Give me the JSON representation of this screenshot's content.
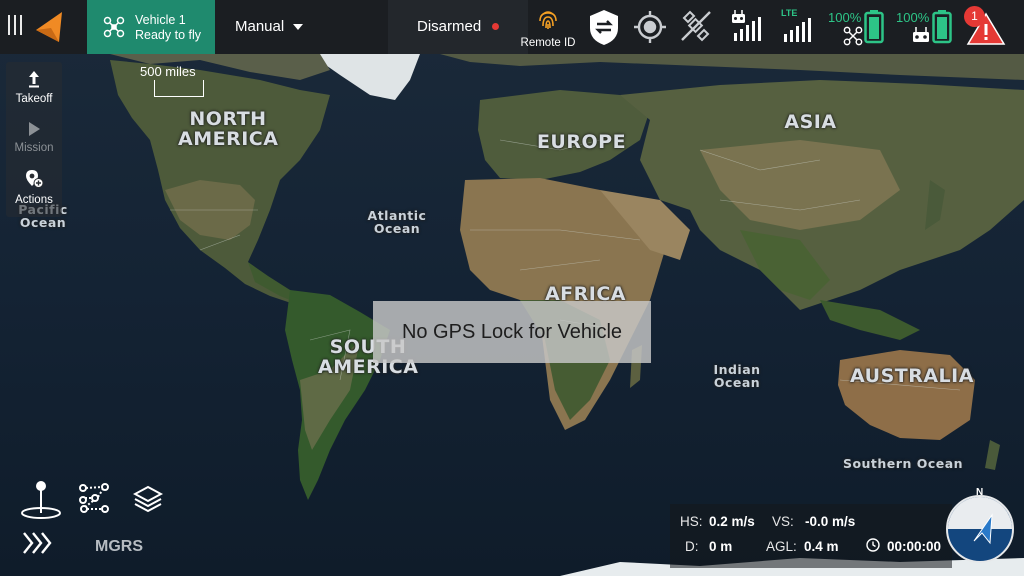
{
  "map": {
    "continents": [
      "NORTH\nAMERICA",
      "EUROPE",
      "ASIA",
      "AFRICA",
      "SOUTH\nAMERICA",
      "AUSTRALIA"
    ],
    "oceans": [
      "Pacific\nOcean",
      "Atlantic\nOcean",
      "Indian\nOcean",
      "Southern Ocean"
    ],
    "scale_label": "500 miles"
  },
  "topbar": {
    "vehicle_name": "Vehicle 1",
    "vehicle_status": "Ready to fly",
    "flight_mode": "Manual",
    "arm_status": "Disarmed",
    "remote_id_label": "Remote ID",
    "lte_label": "LTE",
    "drone_battery": "100%",
    "controller_battery": "100%",
    "alert_count": "1",
    "colors": {
      "vehicle_bg": "#1f8a6e",
      "battery": "#2dc487",
      "alert": "#e53935",
      "remote_id": "#f4a024",
      "logo": "#f08a24"
    }
  },
  "left_tools": {
    "takeoff": "Takeoff",
    "mission": "Mission",
    "actions": "Actions"
  },
  "toast": {
    "message": "No GPS Lock for Vehicle"
  },
  "bottom": {
    "coord_format": "MGRS",
    "icons": [
      "waypoint-pin-icon",
      "route-plan-icon",
      "layers-icon",
      "chevron-expand-icon"
    ]
  },
  "telemetry": {
    "hs_label": "HS:",
    "hs_value": "0.2 m/s",
    "vs_label": "VS:",
    "vs_value": "-0.0 m/s",
    "d_label": "D:",
    "d_value": "0 m",
    "agl_label": "AGL:",
    "agl_value": "0.4 m",
    "time_value": "00:00:00"
  },
  "compass": {
    "north_label": "N"
  }
}
